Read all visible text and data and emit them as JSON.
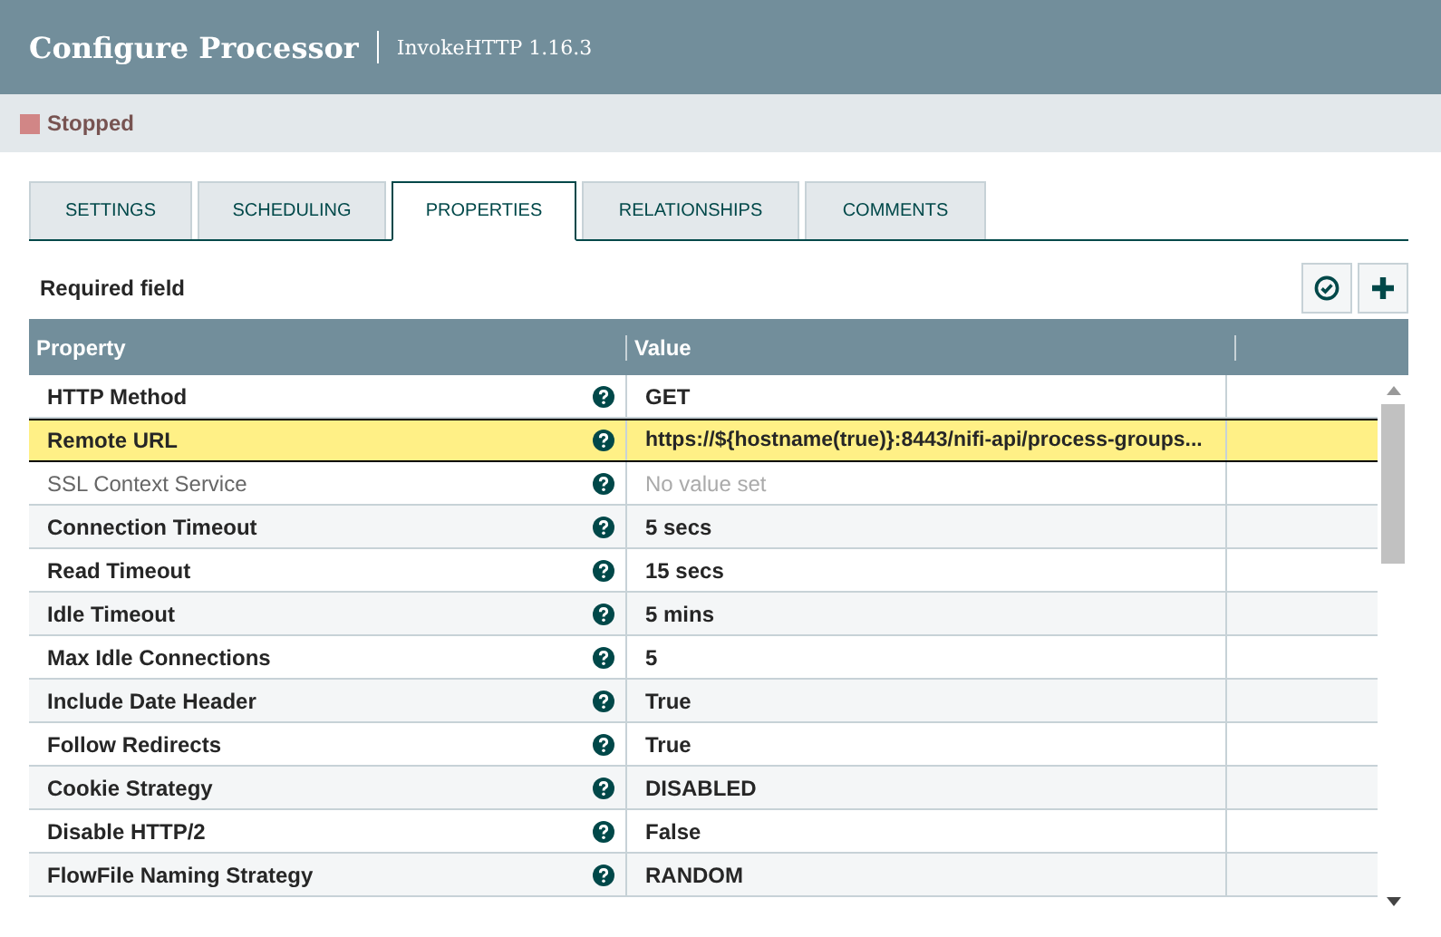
{
  "header": {
    "title": "Configure Processor",
    "subtitle": "InvokeHTTP 1.16.3"
  },
  "status": {
    "label": "Stopped",
    "color": "#d18686"
  },
  "tabs": [
    {
      "label": "SETTINGS",
      "selected": false
    },
    {
      "label": "SCHEDULING",
      "selected": false
    },
    {
      "label": "PROPERTIES",
      "selected": true
    },
    {
      "label": "RELATIONSHIPS",
      "selected": false
    },
    {
      "label": "COMMENTS",
      "selected": false
    }
  ],
  "required_label": "Required field",
  "table": {
    "columns": [
      "Property",
      "Value"
    ],
    "rows": [
      {
        "property": "HTTP Method",
        "required": true,
        "value": "GET",
        "unset": false,
        "selected": false
      },
      {
        "property": "Remote URL",
        "required": true,
        "value": "https://${hostname(true)}:8443/nifi-api/process-groups...",
        "unset": false,
        "selected": true
      },
      {
        "property": "SSL Context Service",
        "required": false,
        "value": "No value set",
        "unset": true,
        "selected": false
      },
      {
        "property": "Connection Timeout",
        "required": true,
        "value": "5 secs",
        "unset": false,
        "selected": false
      },
      {
        "property": "Read Timeout",
        "required": true,
        "value": "15 secs",
        "unset": false,
        "selected": false
      },
      {
        "property": "Idle Timeout",
        "required": true,
        "value": "5 mins",
        "unset": false,
        "selected": false
      },
      {
        "property": "Max Idle Connections",
        "required": true,
        "value": "5",
        "unset": false,
        "selected": false
      },
      {
        "property": "Include Date Header",
        "required": true,
        "value": "True",
        "unset": false,
        "selected": false
      },
      {
        "property": "Follow Redirects",
        "required": true,
        "value": "True",
        "unset": false,
        "selected": false
      },
      {
        "property": "Cookie Strategy",
        "required": true,
        "value": "DISABLED",
        "unset": false,
        "selected": false
      },
      {
        "property": "Disable HTTP/2",
        "required": true,
        "value": "False",
        "unset": false,
        "selected": false
      },
      {
        "property": "FlowFile Naming Strategy",
        "required": true,
        "value": "RANDOM",
        "unset": false,
        "selected": false
      }
    ]
  }
}
